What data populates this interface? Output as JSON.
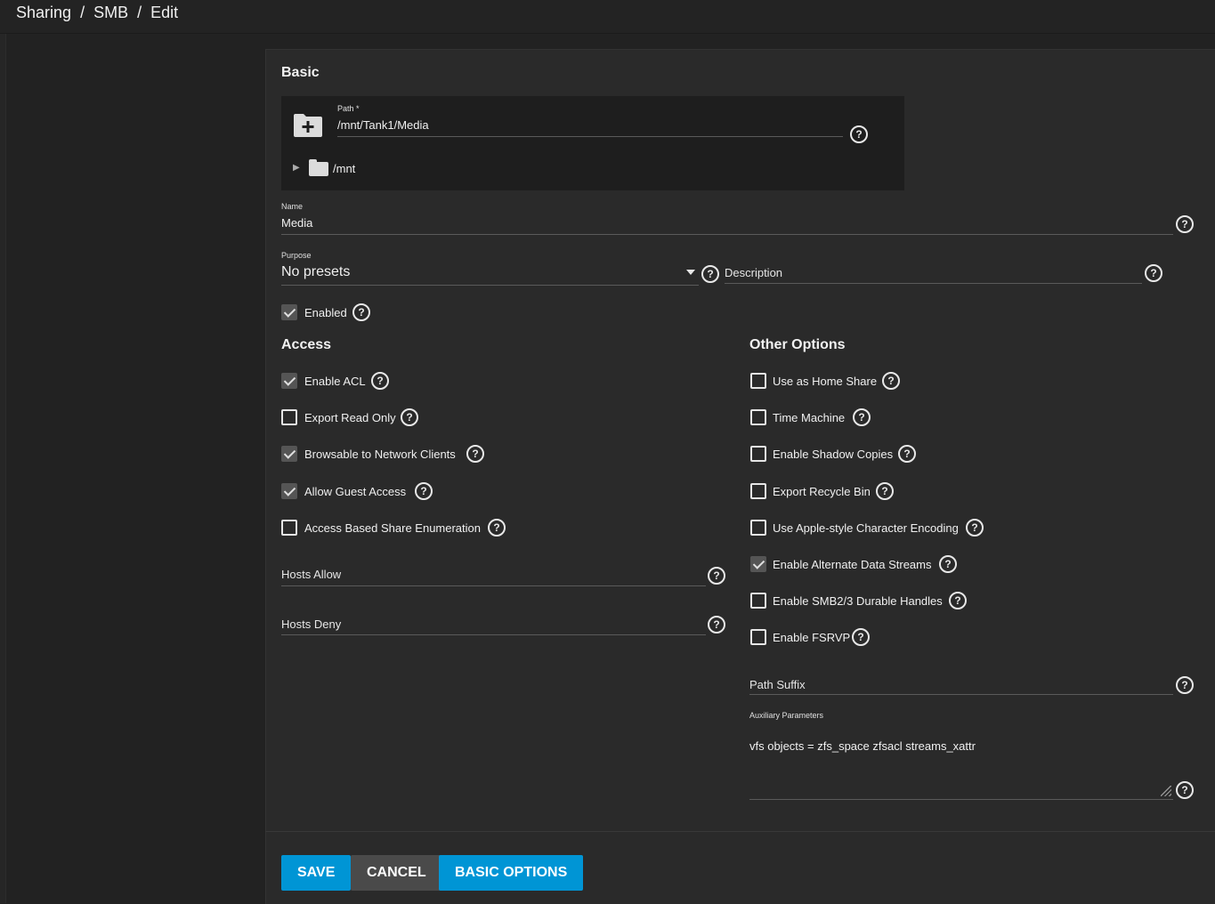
{
  "breadcrumb": {
    "item1": "Sharing",
    "item2": "SMB",
    "item3": "Edit",
    "separator": "/"
  },
  "basic": {
    "title": "Basic",
    "path_label": "Path *",
    "path_value": "/mnt/Tank1/Media",
    "tree_node": "/mnt",
    "name_label": "Name",
    "name_value": "Media",
    "purpose_label": "Purpose",
    "purpose_value": "No presets",
    "description_placeholder": "Description",
    "enabled_label": "Enabled",
    "enabled_checked": true
  },
  "access": {
    "title": "Access",
    "options": [
      {
        "label": "Enable ACL",
        "checked": true
      },
      {
        "label": "Export Read Only",
        "checked": false
      },
      {
        "label": "Browsable to Network Clients",
        "checked": true
      },
      {
        "label": "Allow Guest Access",
        "checked": true
      },
      {
        "label": "Access Based Share Enumeration",
        "checked": false
      }
    ],
    "hosts_allow_placeholder": "Hosts Allow",
    "hosts_deny_placeholder": "Hosts Deny"
  },
  "other": {
    "title": "Other Options",
    "options": [
      {
        "label": "Use as Home Share",
        "checked": false
      },
      {
        "label": "Time Machine",
        "checked": false
      },
      {
        "label": "Enable Shadow Copies",
        "checked": false
      },
      {
        "label": "Export Recycle Bin",
        "checked": false
      },
      {
        "label": "Use Apple-style Character Encoding",
        "checked": false
      },
      {
        "label": "Enable Alternate Data Streams",
        "checked": true
      },
      {
        "label": "Enable SMB2/3 Durable Handles",
        "checked": false
      },
      {
        "label": "Enable FSRVP",
        "checked": false
      }
    ],
    "path_suffix_placeholder": "Path Suffix",
    "aux_label": "Auxiliary Parameters",
    "aux_value": "vfs objects = zfs_space zfsacl streams_xattr"
  },
  "buttons": {
    "save": "SAVE",
    "cancel": "CANCEL",
    "basic_options": "BASIC OPTIONS"
  },
  "help_glyph": "?",
  "colors": {
    "primary": "#0095d5",
    "cancel": "#4a4a4a",
    "background": "#222222",
    "card": "#2a2a2a"
  },
  "icons": [
    "folder-add-icon",
    "folder-icon",
    "caret-right-icon",
    "dropdown-arrow-icon",
    "help-icon",
    "check-icon"
  ]
}
